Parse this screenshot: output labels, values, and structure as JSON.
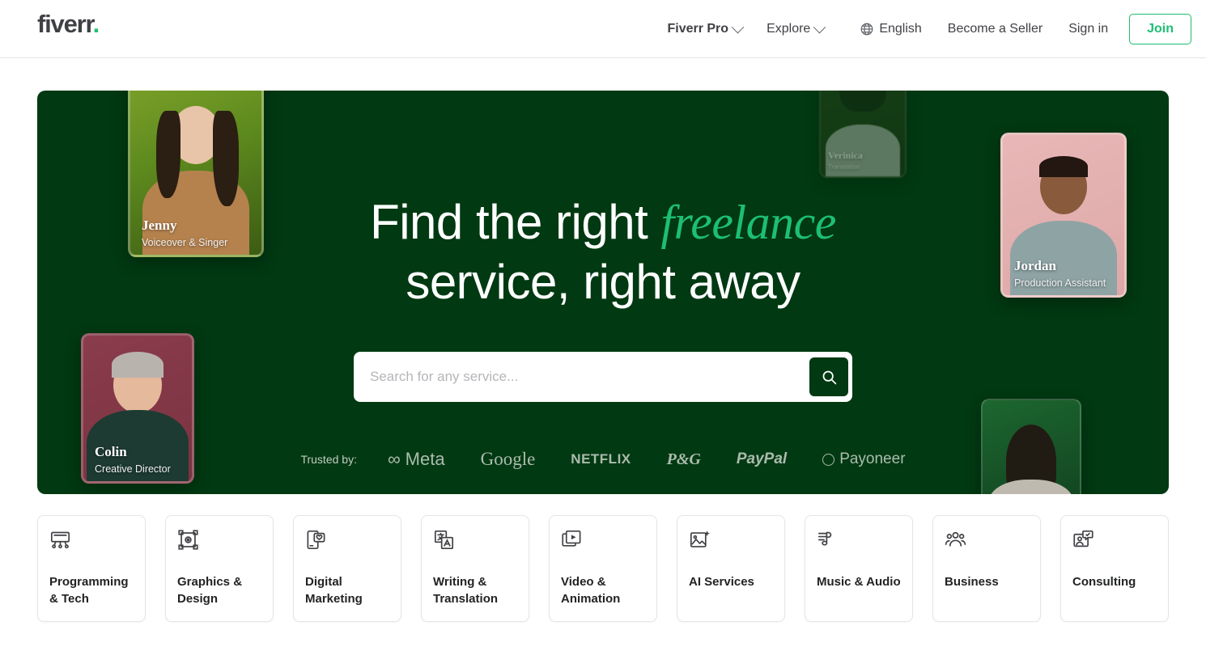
{
  "header": {
    "logo_text": "fiverr",
    "logo_dot": ".",
    "nav": [
      {
        "label": "Fiverr Pro",
        "icon": "chevron-down-icon",
        "has_chevron": true
      },
      {
        "label": "Explore",
        "icon": "chevron-down-icon",
        "has_chevron": true
      },
      {
        "label": "English",
        "icon": "globe-icon",
        "has_chevron": false
      },
      {
        "label": "Become a Seller",
        "icon": "",
        "has_chevron": false
      },
      {
        "label": "Sign in",
        "icon": "",
        "has_chevron": false
      }
    ],
    "join_label": "Join"
  },
  "hero": {
    "headline_part1": "Find the right ",
    "headline_accent": "freelance",
    "headline_part2": " service, right away",
    "background_color": "#013912",
    "accent_color": "#1dbf73",
    "search": {
      "placeholder": "Search for any service...",
      "value": "",
      "button_icon": "search-icon"
    },
    "trusted": {
      "label": "Trusted by:",
      "brands": [
        {
          "name": "Meta",
          "glyph": "∞"
        },
        {
          "name": "Google",
          "glyph": ""
        },
        {
          "name": "NETFLIX",
          "glyph": ""
        },
        {
          "name": "P&G",
          "glyph": ""
        },
        {
          "name": "PayPal",
          "glyph": ""
        },
        {
          "name": "Payoneer",
          "glyph": "circle-icon"
        }
      ]
    },
    "profile_cards": [
      {
        "name": "Jenny",
        "role": "Voiceover & Singer"
      },
      {
        "name": "Colin",
        "role": "Creative Director"
      },
      {
        "name": "Jordan",
        "role": "Production Assistant"
      },
      {
        "name": "Verinica",
        "role": "Translation"
      },
      {
        "name": "",
        "role": ""
      }
    ]
  },
  "categories": [
    {
      "label": "Programming\n& Tech",
      "icon": "monitor-stand-icon"
    },
    {
      "label": "Graphics &\nDesign",
      "icon": "vector-frame-icon"
    },
    {
      "label": "Digital\nMarketing",
      "icon": "phone-heart-icon"
    },
    {
      "label": "Writing &\nTranslation",
      "icon": "translate-icon"
    },
    {
      "label": "Video &\nAnimation",
      "icon": "video-play-icon"
    },
    {
      "label": "AI Services",
      "icon": "image-sparkle-icon"
    },
    {
      "label": "Music & Audio",
      "icon": "music-note-icon"
    },
    {
      "label": "Business",
      "icon": "people-group-icon"
    },
    {
      "label": "Consulting",
      "icon": "person-chat-icon"
    }
  ]
}
